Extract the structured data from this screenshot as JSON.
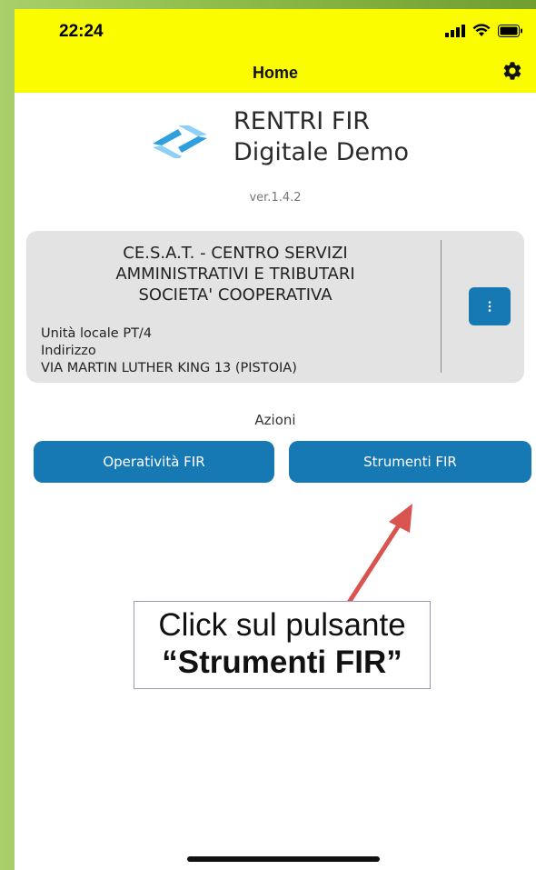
{
  "status_bar": {
    "time": "22:24"
  },
  "header": {
    "title": "Home"
  },
  "app": {
    "name_line1": "RENTRI FIR",
    "name_line2": "Digitale Demo",
    "version": "ver.1.4.2"
  },
  "company_card": {
    "name_line1": "CE.S.A.T. - CENTRO SERVIZI",
    "name_line2": "AMMINISTRATIVI E TRIBUTARI",
    "name_line3": "SOCIETA' COOPERATIVA",
    "unit": "Unità locale PT/4",
    "address_label": "Indirizzo",
    "address": "VIA MARTIN LUTHER KING 13 (PISTOIA)"
  },
  "actions": {
    "label": "Azioni",
    "operativita_button": "Operatività FIR",
    "strumenti_button": "Strumenti FIR"
  },
  "annotation": {
    "line1": "Click sul pulsante",
    "line2": "“Strumenti FIR”"
  },
  "colors": {
    "header_bg": "#fcfc00",
    "button_blue": "#1679b4",
    "card_bg": "#e3e3e3",
    "arrow": "#d9534f"
  },
  "icons": [
    "signal-icon",
    "wifi-icon",
    "battery-icon",
    "settings-gear-icon",
    "app-logo-icon",
    "more-vertical-icon",
    "annotation-arrow"
  ]
}
